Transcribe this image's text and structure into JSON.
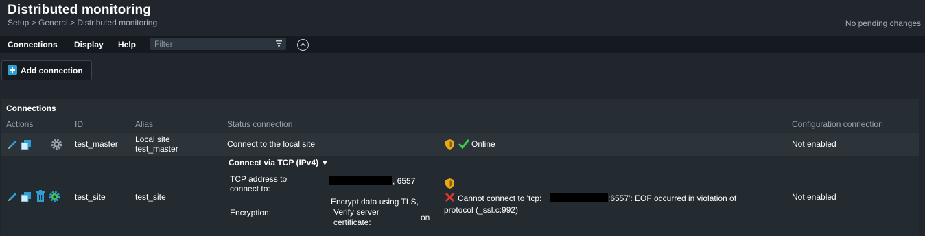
{
  "header": {
    "title": "Distributed monitoring",
    "breadcrumb": "Setup > General > Distributed monitoring",
    "pending": "No pending changes"
  },
  "menu": {
    "items": [
      "Connections",
      "Display",
      "Help"
    ],
    "filter_placeholder": "Filter"
  },
  "toolbar": {
    "add_label": "Add connection"
  },
  "table": {
    "title": "Connections",
    "columns": [
      "Actions",
      "ID",
      "Alias",
      "Status connection",
      "Configuration connection"
    ],
    "rows": [
      {
        "id": "test_master",
        "alias_line1": "Local site",
        "alias_line2": "test_master",
        "status_text": "Connect to the local site",
        "status": "Online",
        "config": "Not enabled"
      },
      {
        "id": "test_site",
        "alias": "test_site",
        "connect_via": "Connect via TCP (IPv4) ▼",
        "tcp_label_1": "TCP address to",
        "tcp_label_2": "connect to:",
        "tcp_port": ", 6557",
        "encryption_label": "Encryption:",
        "encrypt_value": "Encrypt data using TLS,",
        "verify_label_1": "Verify server",
        "verify_label_2": "certificate:",
        "verify_value": "on",
        "error_prefix": "Cannot connect to 'tcp:",
        "error_suffix": ":6557': EOF occurred in violation of",
        "error_line2": "protocol (_ssl.c:992)",
        "config": "Not enabled"
      }
    ]
  },
  "colors": {
    "accent": "#2e9fd6",
    "ok": "#3ec94b",
    "error": "#e0392b",
    "shield": "#e8a818"
  },
  "icons": [
    "filter-icon",
    "collapse-icon",
    "add-icon",
    "edit-icon",
    "clone-icon",
    "gear-icon",
    "delete-icon",
    "settings-icon",
    "shield-icon",
    "check-icon",
    "error-icon"
  ]
}
